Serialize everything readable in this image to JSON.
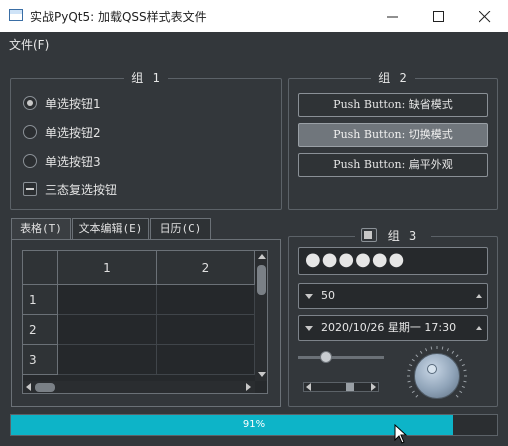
{
  "window": {
    "title": "实战PyQt5: 加载QSS样式表文件"
  },
  "menu": {
    "file": "文件(F)"
  },
  "group1": {
    "title": "组 1",
    "radios": [
      {
        "label": "单选按钮1",
        "checked": true
      },
      {
        "label": "单选按钮2",
        "checked": false
      },
      {
        "label": "单选按钮3",
        "checked": false
      }
    ],
    "tristate": {
      "label": "三态复选按钮",
      "state": "partial"
    }
  },
  "group2": {
    "title": "组 2",
    "buttons": [
      {
        "label": "Push Button: 缺省模式"
      },
      {
        "label": "Push Button: 切换模式",
        "checked": true
      },
      {
        "label": "Push Button: 扁平外观"
      }
    ]
  },
  "tabs": [
    {
      "label": "表格(T)",
      "active": true
    },
    {
      "label": "文本编辑(E)",
      "active": false
    },
    {
      "label": "日历(C)",
      "active": false
    }
  ],
  "table": {
    "columns": [
      "1",
      "2"
    ],
    "rows": [
      "1",
      "2",
      "3"
    ]
  },
  "group3": {
    "title": "组 3",
    "checked": true,
    "password": "●●●●●●",
    "spin_value": "50",
    "datetime": "2020/10/26 星期一 17:30",
    "slider_value": 0.33,
    "dial_value": 0.25
  },
  "progress": {
    "value": 91,
    "text": "91%"
  },
  "colors": {
    "accent": "#0db4c8",
    "background": "#33373b"
  }
}
